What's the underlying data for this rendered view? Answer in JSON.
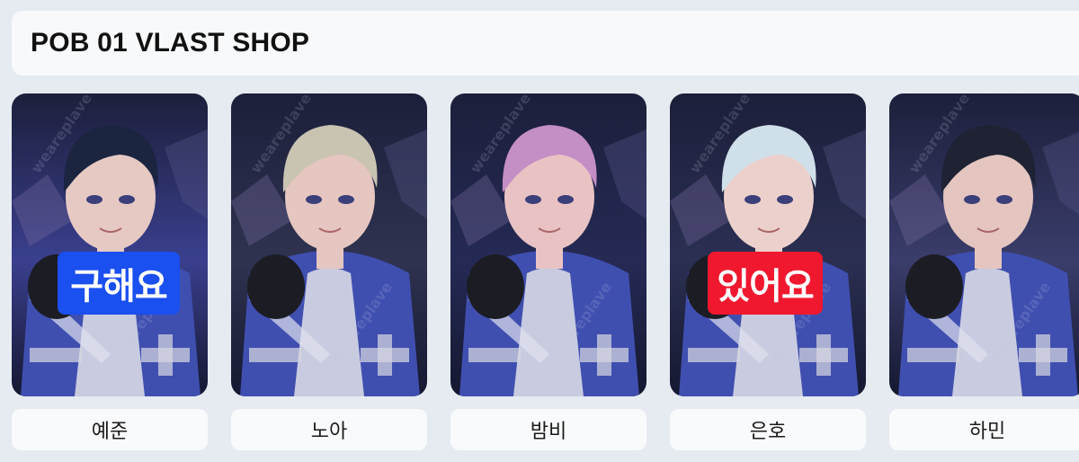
{
  "header": {
    "title": "POB 01 VLAST SHOP"
  },
  "watermark_text": "weareplave",
  "cards": [
    {
      "name": "예준",
      "badge": "구해요",
      "badge_color": "#1a4ff0",
      "hair": "#1b2540",
      "skin": "#e7c9c4",
      "bg": "#3a3f8e"
    },
    {
      "name": "노아",
      "badge": "",
      "badge_color": "",
      "hair": "#c9c3b2",
      "skin": "#e6c6c0",
      "bg": "#2f3350"
    },
    {
      "name": "밤비",
      "badge": "",
      "badge_color": "",
      "hair": "#c48fc4",
      "skin": "#e9c3c4",
      "bg": "#252a55"
    },
    {
      "name": "은호",
      "badge": "있어요",
      "badge_color": "#f0182f",
      "hair": "#cfe0ea",
      "skin": "#ecd0cb",
      "bg": "#2b2f52"
    },
    {
      "name": "하민",
      "badge": "",
      "badge_color": "",
      "hair": "#1e2233",
      "skin": "#e4c5bf",
      "bg": "#3a3d6a"
    }
  ],
  "qty_minus_icon": "minus-icon",
  "qty_plus_icon": "plus-icon",
  "colors": {
    "background": "#e6ebf1",
    "request_badge": "#1a4ff0",
    "have_badge": "#f0182f"
  }
}
